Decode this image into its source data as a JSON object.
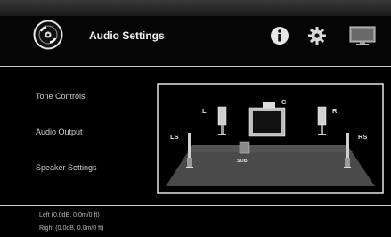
{
  "header": {
    "title": "Audio Settings",
    "icons": [
      "disc-icon",
      "info-icon",
      "gear-icon",
      "display-icon"
    ]
  },
  "menu": {
    "items": [
      {
        "label": "Tone Controls"
      },
      {
        "label": "Audio Output"
      },
      {
        "label": "Speaker Settings"
      }
    ]
  },
  "speakers": {
    "left": "L",
    "center": "C",
    "right": "R",
    "left_surround": "LS",
    "right_surround": "RS",
    "subwoofer": "SUB"
  },
  "status": {
    "line1": "Left (0.0dB, 0.0m/0 ft)",
    "line2": "Right (0.0dB, 0.0m/0 ft)"
  },
  "colors": {
    "background": "#000000",
    "divider": "#cfcfcf",
    "text": "#d8d8d8"
  }
}
